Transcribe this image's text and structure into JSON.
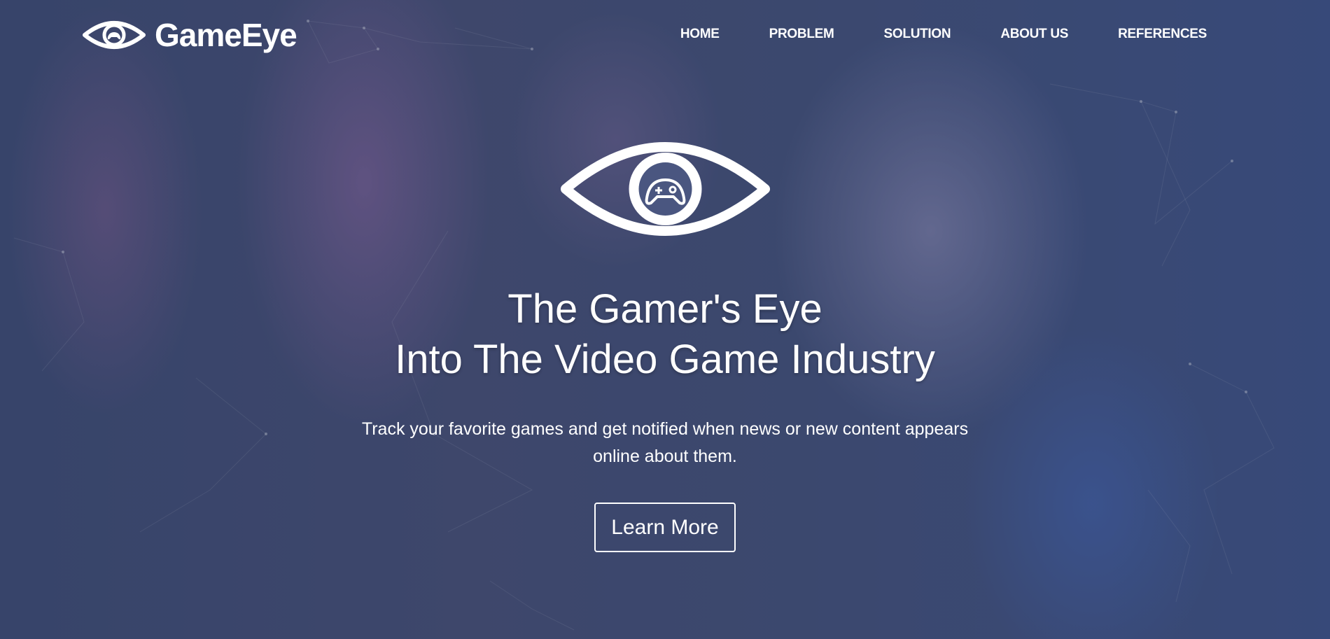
{
  "brand": {
    "name": "GameEye",
    "logo_icon": "eye-gamepad-icon"
  },
  "nav": {
    "items": [
      {
        "label": "HOME"
      },
      {
        "label": "PROBLEM"
      },
      {
        "label": "SOLUTION"
      },
      {
        "label": "ABOUT US"
      },
      {
        "label": "REFERENCES"
      }
    ]
  },
  "hero": {
    "icon": "eye-gamepad-icon",
    "title_line1": "The Gamer's Eye",
    "title_line2": "Into The Video Game Industry",
    "subtitle_line1": "Track your favorite games and get notified when news or new content appears",
    "subtitle_line2": "online about them.",
    "cta_label": "Learn More"
  },
  "colors": {
    "text": "#ffffff",
    "overlay": "#3b4a6b"
  }
}
